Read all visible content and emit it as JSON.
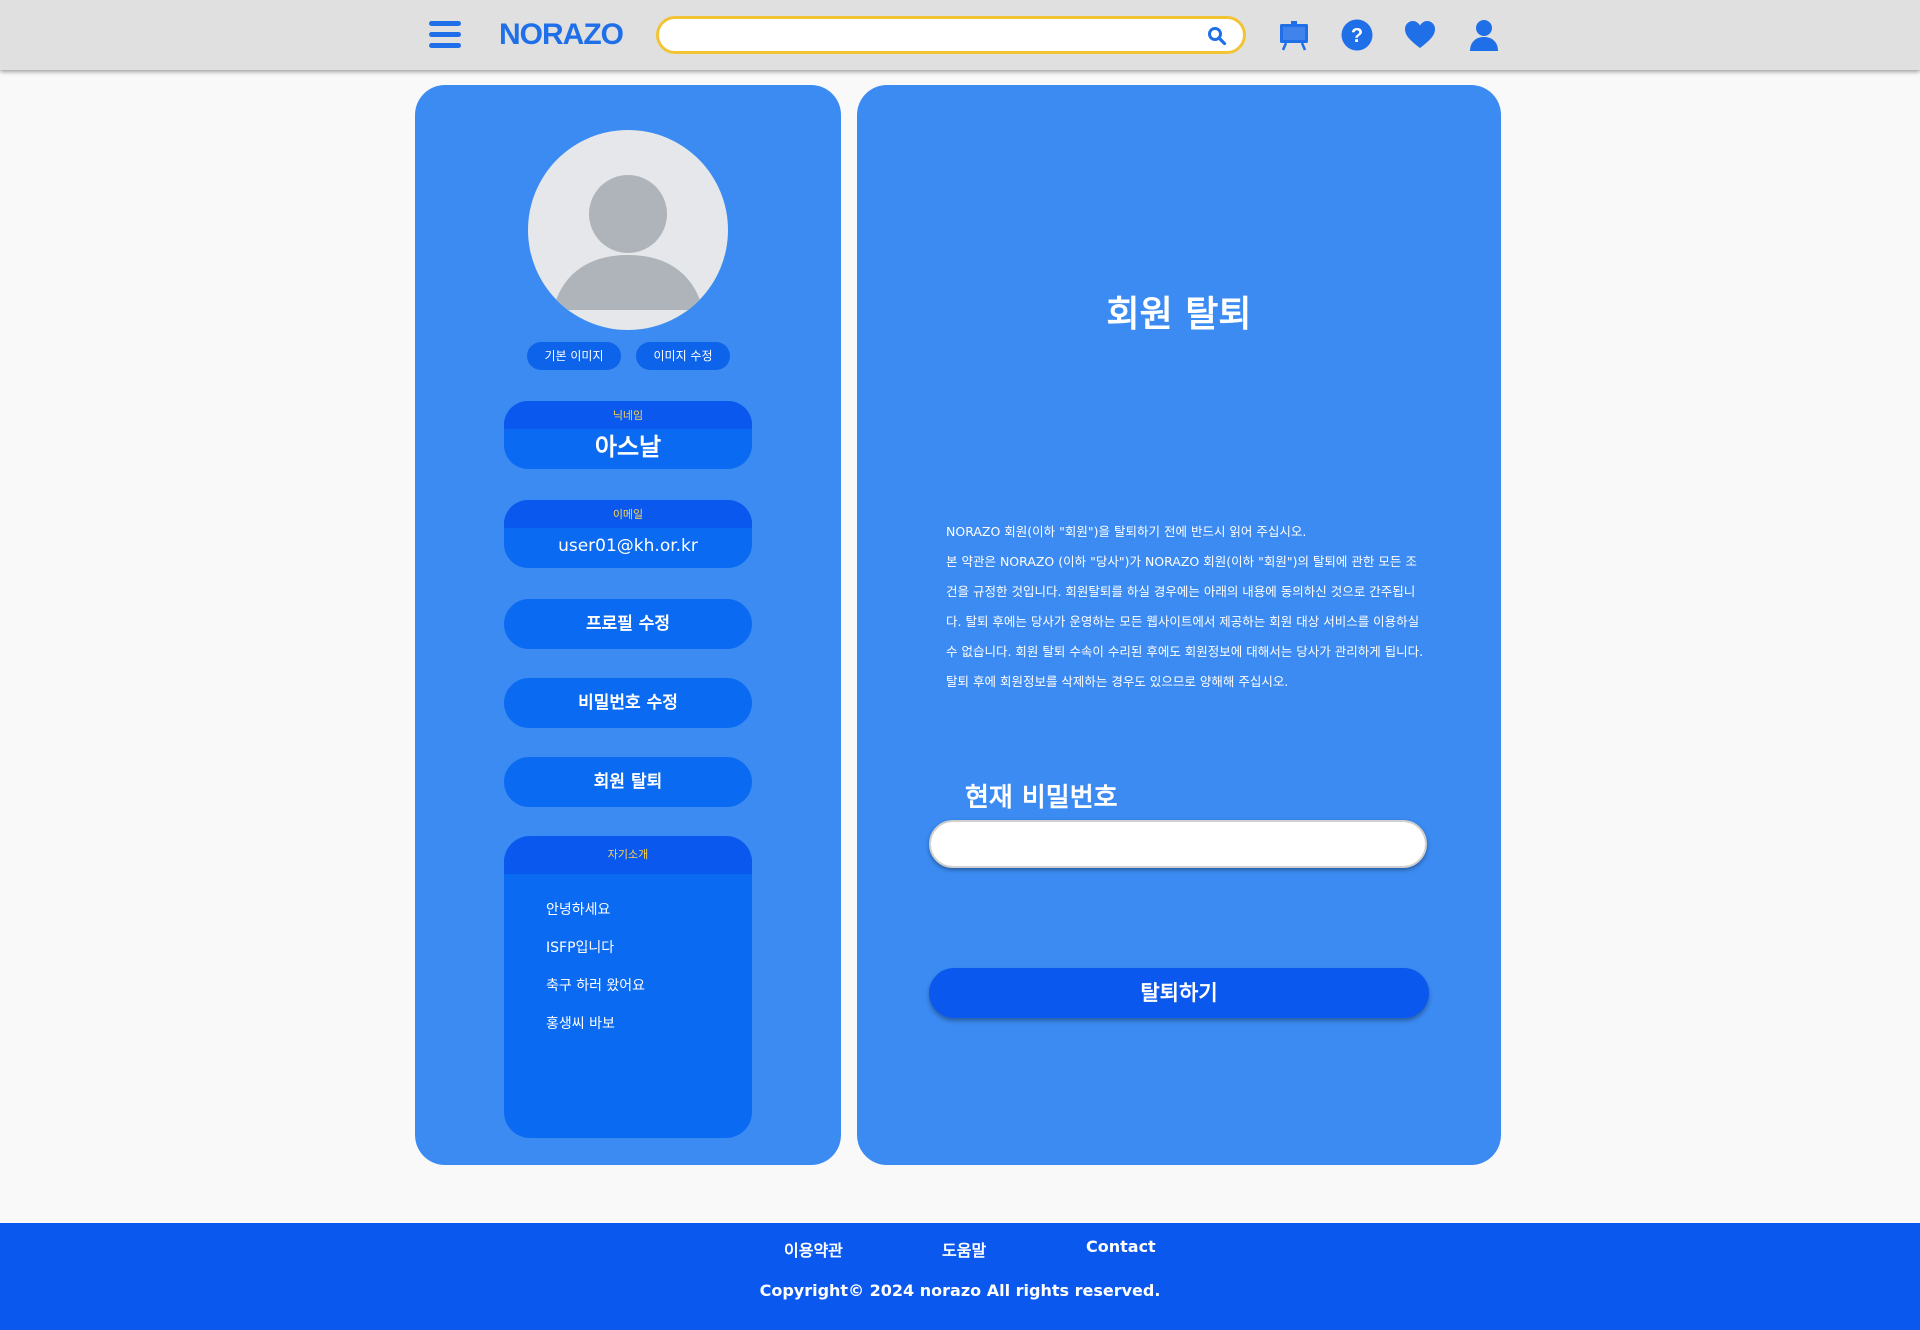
{
  "header": {
    "logo": "NORAZO",
    "search": {
      "value": "",
      "placeholder": ""
    },
    "icons": [
      "menu-icon",
      "search-icon",
      "board-icon",
      "help-icon",
      "heart-icon",
      "user-icon"
    ]
  },
  "profile": {
    "default_image_label": "기본 이미지",
    "edit_image_label": "이미지 수정",
    "nickname_label": "닉네임",
    "nickname": "아스날",
    "email_label": "이메일",
    "email": "user01@kh.or.kr",
    "menu": {
      "edit_profile": "프로필 수정",
      "change_password": "비밀번호 수정",
      "withdraw": "회원 탈퇴"
    },
    "intro_label": "자기소개",
    "intro_lines": [
      "안녕하세요",
      "ISFP입니다",
      "축구 하러 왔어요",
      "홍생씨 바보"
    ]
  },
  "withdraw": {
    "title": "회원 탈퇴",
    "notice": [
      "NORAZO 회원(이하 \"회원\")을 탈퇴하기 전에 반드시 읽어 주십시오.",
      "본 약관은 NORAZO (이하 \"당사\")가 NORAZO 회원(이하 \"회원\")의 탈퇴에 관한 모든 조건을 규정한 것입니다. 회원탈퇴를 하실 경우에는 아래의 내용에 동의하신 것으로 간주됩니다. 탈퇴 후에는 당사가 운영하는 모든 웹사이트에서 제공하는 회원 대상 서비스를 이용하실 수 없습니다. 회원 탈퇴 수속이 수리된 후에도 회원정보에 대해서는 당사가 관리하게 됩니다. 탈퇴 후에 회원정보를 삭제하는 경우도 있으므로 양해해 주십시오."
    ],
    "password_label": "현재 비밀번호",
    "password_value": "",
    "submit_label": "탈퇴하기"
  },
  "footer": {
    "links": [
      "이용약관",
      "도움말",
      "Contact"
    ],
    "copyright": "Copyright© 2024 norazo All rights reserved."
  },
  "colors": {
    "panel": "#3b8bf2",
    "accent": "#0a58ee",
    "box": "#0a6af2",
    "label_yellow": "#ffd452",
    "search_border": "#f2c434",
    "header_bg": "#e0e0e0"
  }
}
